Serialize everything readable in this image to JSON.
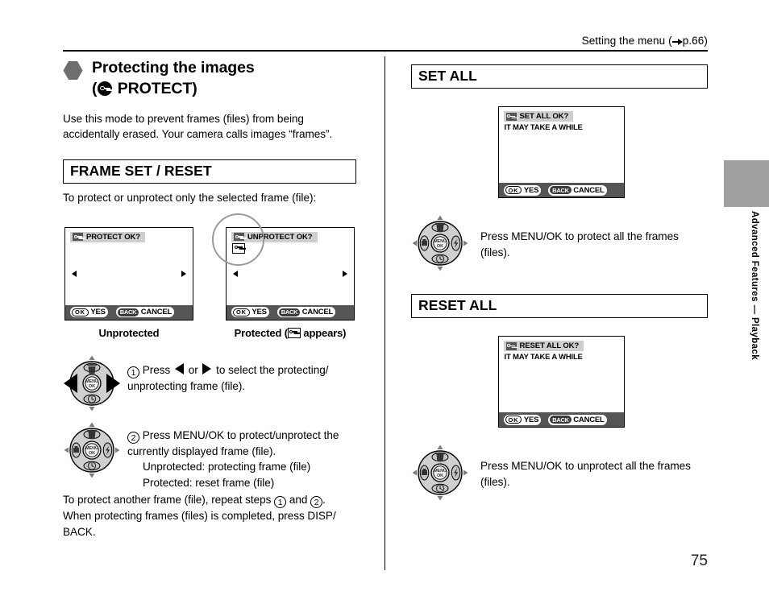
{
  "header": {
    "reference": "Setting the menu (",
    "reference_page": "p.66)"
  },
  "side_tab": {
    "label": "Advanced Features — Playback"
  },
  "footer": {
    "page_number": "75"
  },
  "left_column": {
    "title_line1": "Protecting the images",
    "title_line2_open": "(",
    "title_line2_close": "PROTECT)",
    "intro": "Use this mode to prevent frames (files) from being accidentally erased. Your camera calls images “frames”.",
    "section_heading": "FRAME SET / RESET",
    "section_caption": "To protect or unprotect only the selected frame (file):",
    "lcd_unprotected": {
      "title": "PROTECT OK?",
      "ok_chip": "OK",
      "ok_label": "YES",
      "back_chip": "BACK",
      "back_label": "CANCEL",
      "caption": "Unprotected"
    },
    "lcd_protected": {
      "title": "UNPROTECT OK?",
      "ok_chip": "OK",
      "ok_label": "YES",
      "back_chip": "BACK",
      "back_label": "CANCEL",
      "caption_pre": "Protected (",
      "caption_post": " appears)"
    },
    "steps": [
      {
        "number": "1",
        "text_pre": "Press ",
        "text_mid": " or ",
        "text_post": " to select the protecting/ unprotecting frame (file)."
      },
      {
        "number": "2",
        "line1": "Press MENU/OK to protect/unprotect the currently displayed frame (file).",
        "line2": "Unprotected: protecting frame (file)",
        "line3": "Protected: reset frame (file)"
      }
    ],
    "closing_pre": "To protect another frame (file), repeat steps ",
    "closing_mid": " and ",
    "closing_post": ".",
    "closing_line2": "When protecting frames (files) is completed, press DISP/ BACK.",
    "closing_num_1": "1",
    "closing_num_2": "2"
  },
  "right_column": {
    "set_all": {
      "heading": "SET ALL",
      "lcd": {
        "title": "SET ALL OK?",
        "subtitle": "IT MAY TAKE A WHILE",
        "ok_chip": "OK",
        "ok_label": "YES",
        "back_chip": "BACK",
        "back_label": "CANCEL"
      },
      "instruction": "Press MENU/OK to protect all the frames (files)."
    },
    "reset_all": {
      "heading": "RESET ALL",
      "lcd": {
        "title": "RESET ALL OK?",
        "subtitle": "IT MAY TAKE A WHILE",
        "ok_chip": "OK",
        "ok_label": "YES",
        "back_chip": "BACK",
        "back_label": "CANCEL"
      },
      "instruction": "Press MENU/OK to unprotect all the frames (files)."
    }
  },
  "navpad": {
    "center_line1": "MENU",
    "center_line2": "OK",
    "top_icon": "trash-icon",
    "bottom_icon": "self-timer-icon",
    "left_icon": "macro-icon",
    "right_icon": "flash-icon"
  },
  "colors": {
    "tab_gray": "#a0a0a0",
    "lcd_bar": "#555555",
    "title_highlight": "#cfcfcf",
    "bullet_gray": "#6e6e6e"
  }
}
